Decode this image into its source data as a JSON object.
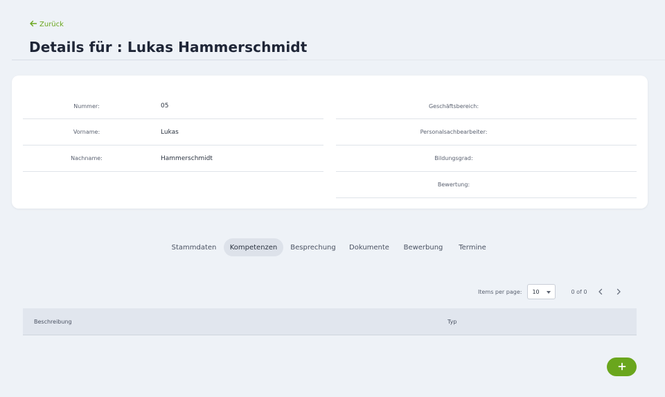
{
  "header": {
    "back_label": "Zurück",
    "title": "Details für : Lukas Hammerschmidt"
  },
  "details": {
    "left": [
      {
        "label": "Nummer:",
        "value": "05"
      },
      {
        "label": "Vorname:",
        "value": "Lukas"
      },
      {
        "label": "Nachname:",
        "value": "Hammerschmidt"
      }
    ],
    "right": [
      {
        "label": "Geschäftsbereich:",
        "value": ""
      },
      {
        "label": "Personalsachbearbeiter:",
        "value": ""
      },
      {
        "label": "Bildungsgrad:",
        "value": ""
      },
      {
        "label": "Bewertung:",
        "value": ""
      }
    ]
  },
  "tabs": [
    {
      "label": "Stammdaten",
      "active": false
    },
    {
      "label": "Kompetenzen",
      "active": true
    },
    {
      "label": "Besprechung",
      "active": false
    },
    {
      "label": "Dokumente",
      "active": false
    },
    {
      "label": "Bewerbung",
      "active": false
    },
    {
      "label": "Termine",
      "active": false
    }
  ],
  "pagination": {
    "items_per_page_label": "Items per page:",
    "page_size": "10",
    "range": "0 of 0"
  },
  "table": {
    "columns": [
      "Beschreibung",
      "Typ"
    ]
  },
  "colors": {
    "accent": "#6aa61d",
    "background": "#eef2f7",
    "active_tab": "#dde2ea"
  },
  "icons": {
    "back": "arrow-left-icon",
    "prev": "chevron-left-icon",
    "next": "chevron-right-icon",
    "add": "plus-icon"
  }
}
